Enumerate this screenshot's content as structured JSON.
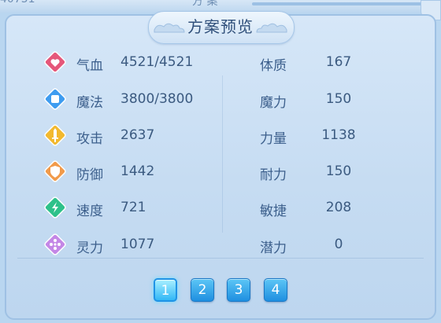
{
  "title": "方案预览",
  "stats": [
    {
      "key": "hp",
      "label": "气血",
      "value": "4521/4521",
      "icon": "heart-icon",
      "color": "#e5577a"
    },
    {
      "key": "mp",
      "label": "魔法",
      "value": "3800/3800",
      "icon": "mana-icon",
      "color": "#3e9cf0"
    },
    {
      "key": "atk",
      "label": "攻击",
      "value": "2637",
      "icon": "sword-icon",
      "color": "#f2b92f"
    },
    {
      "key": "def",
      "label": "防御",
      "value": "1442",
      "icon": "shield-icon",
      "color": "#f19a4a"
    },
    {
      "key": "spd",
      "label": "速度",
      "value": "721",
      "icon": "lightning-icon",
      "color": "#2ec18a"
    },
    {
      "key": "spirit",
      "label": "灵力",
      "value": "1077",
      "icon": "spirit-icon",
      "color": "#c487e6"
    }
  ],
  "attributes": [
    {
      "label": "体质",
      "value": "167"
    },
    {
      "label": "魔力",
      "value": "150"
    },
    {
      "label": "力量",
      "value": "1138"
    },
    {
      "label": "耐力",
      "value": "150"
    },
    {
      "label": "敏捷",
      "value": "208"
    },
    {
      "label": "潜力",
      "value": "0"
    }
  ],
  "pages": [
    "1",
    "2",
    "3",
    "4"
  ],
  "active_page": "1"
}
